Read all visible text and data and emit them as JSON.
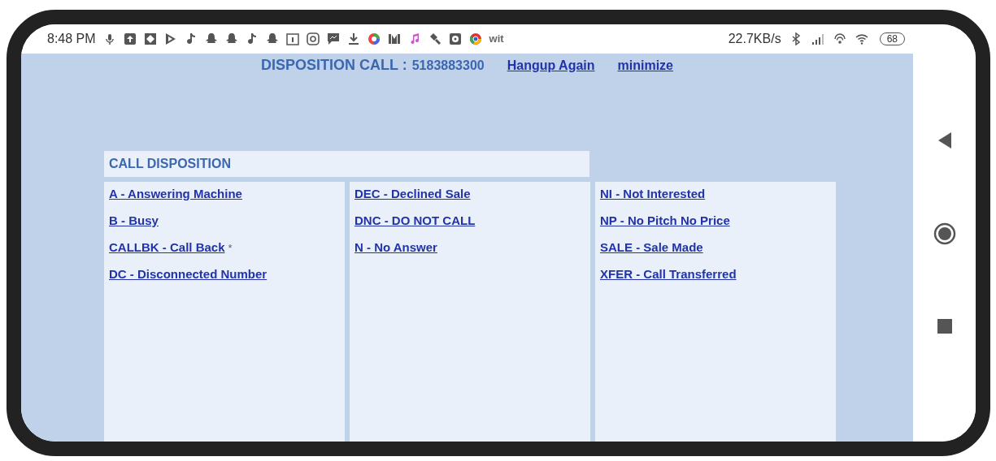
{
  "status_bar": {
    "time": "8:48 PM",
    "app_label": "wit",
    "network_speed": "22.7KB/s",
    "battery": "68"
  },
  "header": {
    "title": "DISPOSITION CALL :",
    "phone_number": "5183883300",
    "links": [
      "Hangup Again",
      "minimize"
    ]
  },
  "disposition": {
    "title": "CALL DISPOSITION",
    "columns": [
      [
        {
          "label": "A - Answering Machine"
        },
        {
          "label": "B - Busy"
        },
        {
          "label": "CALLBK - Call Back",
          "note": "*"
        },
        {
          "label": "DC - Disconnected Number"
        }
      ],
      [
        {
          "label": "DEC - Declined Sale"
        },
        {
          "label": "DNC - DO NOT CALL"
        },
        {
          "label": "N - No Answer"
        }
      ],
      [
        {
          "label": "NI - Not Interested"
        },
        {
          "label": "NP - No Pitch No Price"
        },
        {
          "label": "SALE - Sale Made"
        },
        {
          "label": "XFER - Call Transferred"
        }
      ]
    ]
  }
}
